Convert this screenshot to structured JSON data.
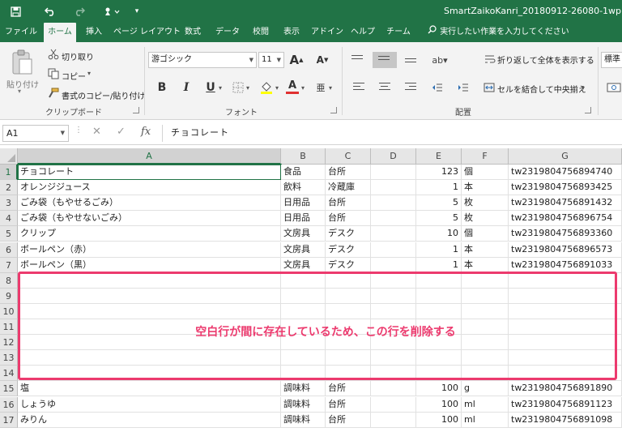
{
  "app": {
    "title": "SmartZaikoKanri_20180912-26080-1wp",
    "accent": "#217346",
    "highlight_color": "#ec3a6e"
  },
  "qat": {
    "save_icon": "save-icon",
    "undo_icon": "undo-icon",
    "redo_icon": "redo-icon",
    "touch_icon": "touch-mode-icon"
  },
  "tabs": [
    "ファイル",
    "ホーム",
    "挿入",
    "ページ レイアウト",
    "数式",
    "データ",
    "校閲",
    "表示",
    "アドイン",
    "ヘルプ",
    "チーム"
  ],
  "active_tab": "ホーム",
  "tell_me": "実行したい作業を入力してください",
  "ribbon": {
    "clipboard": {
      "paste": "貼り付け",
      "cut": "切り取り",
      "copy": "コピー",
      "format_painter": "書式のコピー/貼り付け",
      "label": "クリップボード"
    },
    "font": {
      "name": "游ゴシック",
      "size": "11",
      "label": "フォント",
      "bold": "B",
      "italic": "I",
      "underline": "U",
      "grow": "A",
      "shrink": "A",
      "font_color": "A",
      "phonetic": "亜"
    },
    "alignment": {
      "wrap_text": "折り返して全体を表示する",
      "merge_center": "セルを結合して中央揃え",
      "label": "配置"
    },
    "number": {
      "format": "標準"
    }
  },
  "formula_bar": {
    "name_box": "A1",
    "fx": "fx",
    "value": "チョコレート"
  },
  "columns": [
    "A",
    "B",
    "C",
    "D",
    "E",
    "F",
    "G"
  ],
  "rows": [
    {
      "num": "1",
      "a": "チョコレート",
      "b": "食品",
      "c": "台所",
      "d": "",
      "e": "123",
      "f": "個",
      "g": "tw2319804756894740"
    },
    {
      "num": "2",
      "a": "オレンジジュース",
      "b": "飲料",
      "c": "冷蔵庫",
      "d": "",
      "e": "1",
      "f": "本",
      "g": "tw2319804756893425"
    },
    {
      "num": "3",
      "a": "ごみ袋（もやせるごみ）",
      "b": "日用品",
      "c": "台所",
      "d": "",
      "e": "5",
      "f": "枚",
      "g": "tw2319804756891432"
    },
    {
      "num": "4",
      "a": "ごみ袋（もやせないごみ）",
      "b": "日用品",
      "c": "台所",
      "d": "",
      "e": "5",
      "f": "枚",
      "g": "tw2319804756896754"
    },
    {
      "num": "5",
      "a": "クリップ",
      "b": "文房具",
      "c": "デスク",
      "d": "",
      "e": "10",
      "f": "個",
      "g": "tw2319804756893360"
    },
    {
      "num": "6",
      "a": "ボールペン（赤）",
      "b": "文房具",
      "c": "デスク",
      "d": "",
      "e": "1",
      "f": "本",
      "g": "tw2319804756896573"
    },
    {
      "num": "7",
      "a": "ボールペン（黒）",
      "b": "文房具",
      "c": "デスク",
      "d": "",
      "e": "1",
      "f": "本",
      "g": "tw2319804756891033"
    },
    {
      "num": "8",
      "a": "",
      "b": "",
      "c": "",
      "d": "",
      "e": "",
      "f": "",
      "g": ""
    },
    {
      "num": "9",
      "a": "",
      "b": "",
      "c": "",
      "d": "",
      "e": "",
      "f": "",
      "g": ""
    },
    {
      "num": "10",
      "a": "",
      "b": "",
      "c": "",
      "d": "",
      "e": "",
      "f": "",
      "g": ""
    },
    {
      "num": "11",
      "a": "",
      "b": "",
      "c": "",
      "d": "",
      "e": "",
      "f": "",
      "g": ""
    },
    {
      "num": "12",
      "a": "",
      "b": "",
      "c": "",
      "d": "",
      "e": "",
      "f": "",
      "g": ""
    },
    {
      "num": "13",
      "a": "",
      "b": "",
      "c": "",
      "d": "",
      "e": "",
      "f": "",
      "g": ""
    },
    {
      "num": "14",
      "a": "",
      "b": "",
      "c": "",
      "d": "",
      "e": "",
      "f": "",
      "g": ""
    },
    {
      "num": "15",
      "a": "塩",
      "b": "調味料",
      "c": "台所",
      "d": "",
      "e": "100",
      "f": "g",
      "g": "tw2319804756891890"
    },
    {
      "num": "16",
      "a": "しょうゆ",
      "b": "調味料",
      "c": "台所",
      "d": "",
      "e": "100",
      "f": "ml",
      "g": "tw2319804756891123"
    },
    {
      "num": "17",
      "a": "みりん",
      "b": "調味料",
      "c": "台所",
      "d": "",
      "e": "100",
      "f": "ml",
      "g": "tw2319804756891098"
    }
  ],
  "annotation": "空白行が間に存在しているため、この行を削除する"
}
